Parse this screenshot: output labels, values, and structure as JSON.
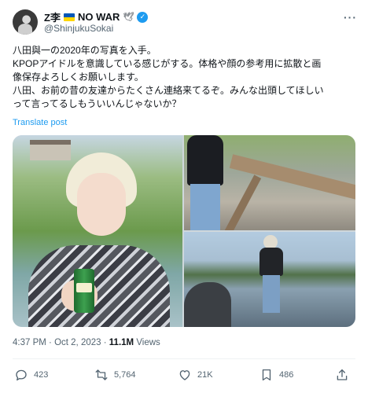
{
  "author": {
    "name": "Z李",
    "badge_text": "NO WAR",
    "handle": "@ShinjukuSokai"
  },
  "tweet": {
    "lines": [
      "八田與一の2020年の写真を入手。",
      "KPOPアイドルを意識している感じがする。体格や顔の参考用に拡散と画",
      "像保存よろしくお願いします。",
      "八田、お前の昔の友達からたくさん連絡来てるぞ。みんな出頭してほしい",
      "って言ってるしもういいんじゃないか？"
    ],
    "translate_label": "Translate post"
  },
  "meta": {
    "time": "4:37 PM",
    "separator": "·",
    "date": "Oct 2, 2023",
    "views_count": "11.1M",
    "views_label": "Views"
  },
  "actions": {
    "replies": "423",
    "reposts": "5,764",
    "likes": "21K",
    "bookmarks": "486"
  },
  "icons": {
    "reply": "reply-icon",
    "repost": "repost-icon",
    "like": "heart-icon",
    "bookmark": "bookmark-icon",
    "share": "share-icon",
    "more": "more-icon",
    "verified": "verified-icon"
  },
  "colors": {
    "accent": "#1d9bf0",
    "secondary_text": "#536471",
    "primary_text": "#0f1419"
  }
}
